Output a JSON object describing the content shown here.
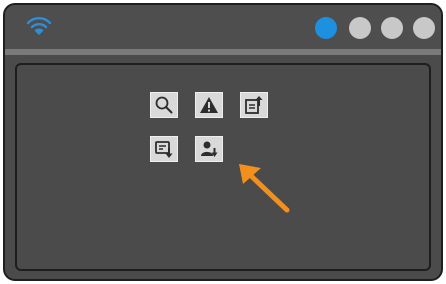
{
  "colors": {
    "window_bg": "#4b4b4b",
    "active_dot": "#1e90e0",
    "inactive_dot": "#c8c8c8",
    "wifi": "#2b8fdc",
    "arrow": "#f3901d",
    "button_bg": "#d9d9d9"
  },
  "titlebar": {
    "wifi_icon": "wifi-icon",
    "dots": [
      "active",
      "inactive",
      "inactive",
      "inactive"
    ]
  },
  "toolbar": {
    "buttons": [
      {
        "icon": "search-icon"
      },
      {
        "icon": "warning-icon"
      },
      {
        "icon": "export-document-icon"
      },
      {
        "icon": "download-form-icon"
      },
      {
        "icon": "user-download-icon"
      }
    ]
  },
  "annotation": {
    "icon": "pointer-arrow-icon",
    "points_to": "user-download-button"
  }
}
